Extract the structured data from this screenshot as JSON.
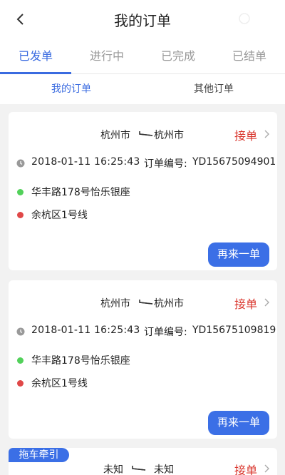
{
  "header": {
    "title": "我的订单"
  },
  "tabs": [
    {
      "label": "已发单"
    },
    {
      "label": "进行中"
    },
    {
      "label": "已完成"
    },
    {
      "label": "已结单"
    }
  ],
  "subtabs": [
    {
      "label": "我的订单"
    },
    {
      "label": "其他订单"
    }
  ],
  "orders": [
    {
      "from": "杭州市",
      "to": "杭州市",
      "status": "接单",
      "datetime": "2018-01-11 16:25:43",
      "order_no_label": "订单编号:",
      "order_no": "YD15675094901",
      "pickup": "华丰路178号怡乐银座",
      "dropoff": "余杭区1号线",
      "button": "再来一单"
    },
    {
      "from": "杭州市",
      "to": "杭州市",
      "status": "接单",
      "datetime": "2018-01-11 16:25:43",
      "order_no_label": "订单编号:",
      "order_no": "YD15675109819",
      "pickup": "华丰路178号怡乐银座",
      "dropoff": "余杭区1号线",
      "button": "再来一单"
    },
    {
      "badge": "拖车牵引",
      "from": "未知",
      "to": "未知",
      "status": "接单"
    }
  ],
  "colors": {
    "accent": "#3a6be0",
    "status": "#d9342b",
    "pickup_dot": "#52d15a",
    "dropoff_dot": "#e04848"
  }
}
